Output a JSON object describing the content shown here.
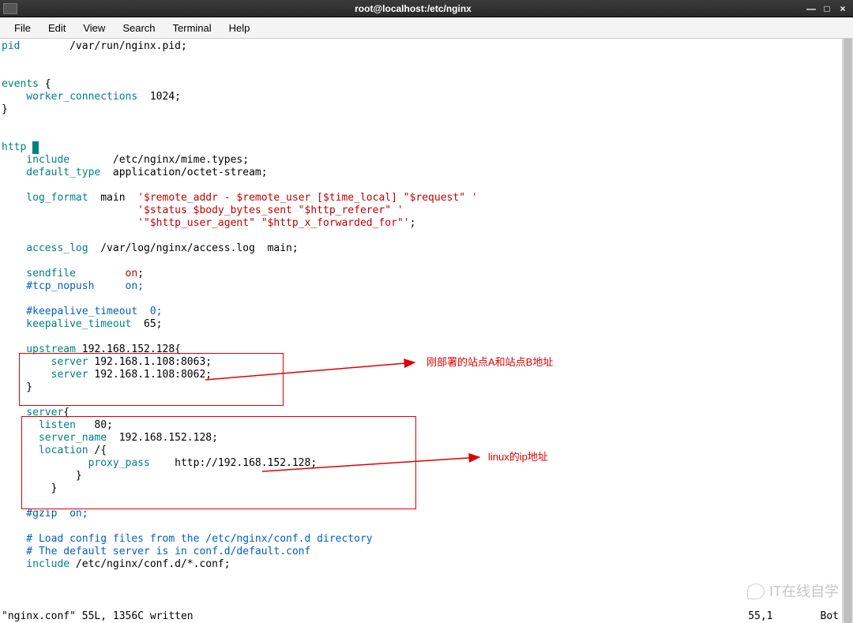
{
  "window": {
    "title": "root@localhost:/etc/nginx",
    "min": "—",
    "max": "□",
    "close": "×"
  },
  "menu": {
    "file": "File",
    "edit": "Edit",
    "view": "View",
    "search": "Search",
    "terminal": "Terminal",
    "help": "Help"
  },
  "code": {
    "l1a": "pid",
    "l1b": "        /var/run/nginx.pid;",
    "l2a": "events",
    "l2b": " {",
    "l3a": "    worker_connections",
    "l3b": "  1024;",
    "l4": "}",
    "l5a": "http",
    "l5b": " ",
    "l6a": "    include",
    "l6b": "       /etc/nginx/mime.types;",
    "l7a": "    default_type",
    "l7b": "  application/octet-stream;",
    "l8a": "    log_format",
    "l8b": "  main  ",
    "l8c": "'$remote_addr - $remote_user [$time_local] \"$request\" '",
    "l9": "                      '$status $body_bytes_sent \"$http_referer\" '",
    "l10a": "                      '\"$http_user_agent\" \"$http_x_forwarded_for\"'",
    "l10b": ";",
    "l11a": "    access_log",
    "l11b": "  /var/log/nginx/access.log  main;",
    "l12a": "    sendfile",
    "l12b": "        ",
    "l12c": "on",
    "l12d": ";",
    "l13": "    #tcp_nopush     on;",
    "l14": "    #keepalive_timeout  0;",
    "l15a": "    keepalive_timeout",
    "l15b": "  65;",
    "l16a": "    upstream",
    "l16b": " 192.168.152.128{",
    "l17a": "        server",
    "l17b": " 192.168.1.108:8063;",
    "l18a": "        server",
    "l18b": " 192.168.1.108:8062;",
    "l19": "    }",
    "l20a": "    server",
    "l20b": "{",
    "l21a": "      listen",
    "l21b": "   80;",
    "l22a": "      server_name",
    "l22b": "  192.168.152.128;",
    "l23a": "      location",
    "l23b": " /{",
    "l24a": "              proxy_pass",
    "l24b": "    http://192.168.152.128;",
    "l25": "            }",
    "l26": "        }",
    "l27": "    #gzip  on;",
    "l28": "    # Load config files from the /etc/nginx/conf.d directory",
    "l29": "    # The default server is in conf.d/default.conf",
    "l30a": "    include",
    "l30b": " /etc/nginx/conf.d/*.conf;"
  },
  "annotations": {
    "a1": "刚部署的站点A和站点B地址",
    "a2": "linux的ip地址"
  },
  "status": {
    "msg": "\"nginx.conf\" 55L, 1356C written",
    "pos": "55,1",
    "bot": "Bot"
  },
  "watermark": "IT在线自学"
}
